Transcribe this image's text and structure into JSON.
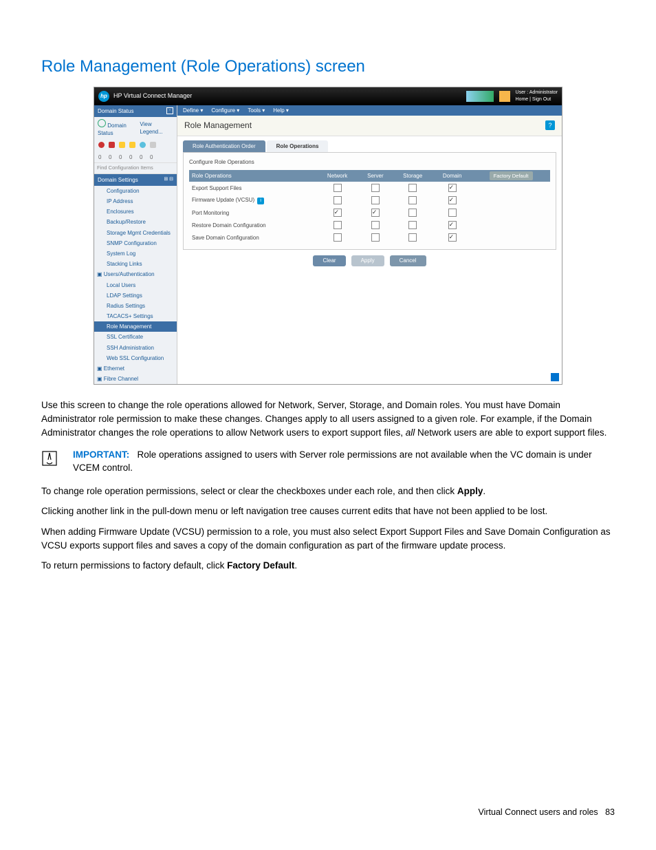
{
  "page_heading": "Role Management (Role Operations) screen",
  "screenshot": {
    "app_title": "HP Virtual Connect Manager",
    "user_line1": "User : Administrator",
    "user_line2": "Home | Sign Out",
    "menubar": [
      "Define ▾",
      "Configure ▾",
      "Tools ▾",
      "Help ▾"
    ],
    "sidebar": {
      "domain_status_header": "Domain Status",
      "domain_status_sub": "Domain Status",
      "view_legend": "View Legend...",
      "find_placeholder": "Find Configuration Items",
      "domain_settings_header": "Domain Settings",
      "items": [
        "Configuration",
        "IP Address",
        "Enclosures",
        "Backup/Restore",
        "Storage Mgmt Credentials",
        "SNMP Configuration",
        "System Log",
        "Stacking Links"
      ],
      "users_auth_header": "Users/Authentication",
      "users_items": [
        "Local Users",
        "LDAP Settings",
        "Radius Settings",
        "TACACS+ Settings",
        "Role Management",
        "SSL Certificate",
        "SSH Administration",
        "Web SSL Configuration"
      ],
      "ethernet_header": "Ethernet",
      "fibre_header": "Fibre Channel"
    },
    "main": {
      "title": "Role Management",
      "tabs": [
        "Role Authentication Order",
        "Role Operations"
      ],
      "panel_label": "Configure Role Operations",
      "table": {
        "col_headers": [
          "Role Operations",
          "Network",
          "Server",
          "Storage",
          "Domain"
        ],
        "factory_label": "Factory Default",
        "rows": [
          {
            "label": "Export Support Files",
            "info": false,
            "cb": [
              false,
              false,
              false,
              true
            ]
          },
          {
            "label": "Firmware Update (VCSU)",
            "info": true,
            "cb": [
              false,
              false,
              false,
              true
            ]
          },
          {
            "label": "Port Monitoring",
            "info": false,
            "cb": [
              true,
              true,
              false,
              false
            ]
          },
          {
            "label": "Restore Domain Configuration",
            "info": false,
            "cb": [
              false,
              false,
              false,
              true
            ]
          },
          {
            "label": "Save Domain Configuration",
            "info": false,
            "cb": [
              false,
              false,
              false,
              true
            ]
          }
        ]
      },
      "buttons": {
        "clear": "Clear",
        "apply": "Apply",
        "cancel": "Cancel"
      }
    }
  },
  "body": {
    "p1a": "Use this screen to change the role operations allowed for Network, Server, Storage, and Domain roles. You must have Domain Administrator role permission to make these changes. Changes apply to all users assigned to a given role. For example, if the Domain Administrator changes the role operations to allow Network users to export support files, ",
    "p1_italic": "all",
    "p1b": " Network users are able to export support files.",
    "important_label": "IMPORTANT:",
    "important_text": "Role operations assigned to users with Server role permissions are not available when the VC domain is under VCEM control.",
    "p2a": "To change role operation permissions, select or clear the checkboxes under each role, and then click ",
    "p2_bold": "Apply",
    "p2b": ".",
    "p3": "Clicking another link in the pull-down menu or left navigation tree causes current edits that have not been applied to be lost.",
    "p4": "When adding Firmware Update (VCSU) permission to a role, you must also select Export Support Files and Save Domain Configuration as VCSU exports support files and saves a copy of the domain configuration as part of the firmware update process.",
    "p5a": "To return permissions to factory default, click ",
    "p5_bold": "Factory Default",
    "p5b": "."
  },
  "footer": {
    "text": "Virtual Connect users and roles",
    "page": "83"
  }
}
